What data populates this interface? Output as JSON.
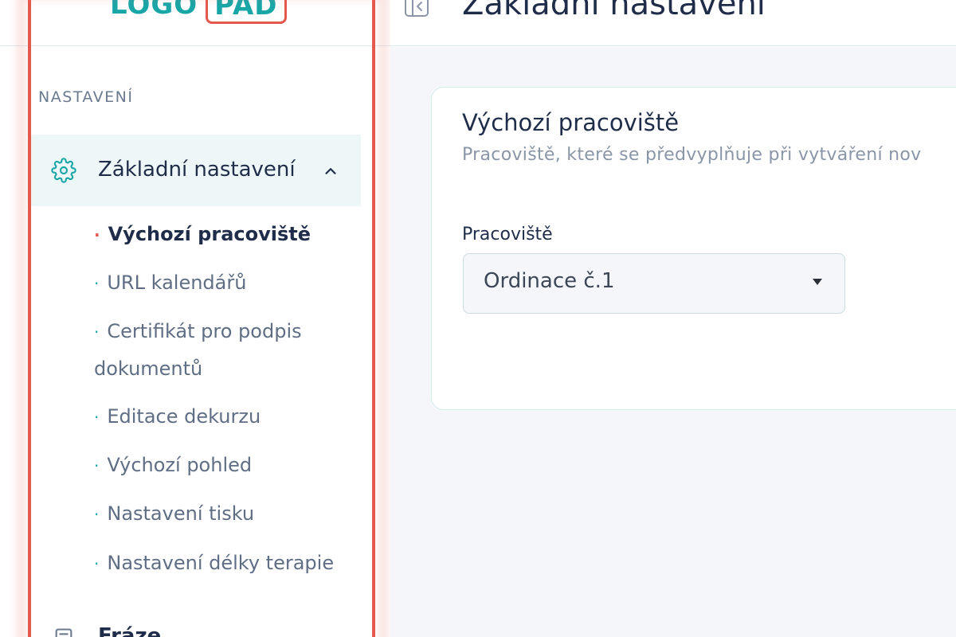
{
  "logo": {
    "left_text": "LOGO",
    "right_text": "PAD"
  },
  "sidebar": {
    "section_label": "NASTAVENÍ",
    "active_group": {
      "label": "Základní nastavení",
      "icon": "gear-icon"
    },
    "sub_items": [
      {
        "label": "Výchozí pracoviště",
        "active": true
      },
      {
        "label": "URL kalendářů",
        "active": false
      },
      {
        "label": "Certifikát pro podpis dokumentů",
        "active": false
      },
      {
        "label": "Editace dekurzu",
        "active": false
      },
      {
        "label": "Výchozí pohled",
        "active": false
      },
      {
        "label": "Nastavení tisku",
        "active": false
      },
      {
        "label": "Nastavení délky terapie",
        "active": false
      }
    ],
    "next_group": {
      "label": "Fráze",
      "icon": "document-icon"
    }
  },
  "header": {
    "title": "Základní nastavení"
  },
  "card": {
    "title": "Výchozí pracoviště",
    "description": "Pracoviště, které se předvyplňuje při vytváření nov",
    "field_label": "Pracoviště",
    "select_value": "Ordinace č.1"
  },
  "colors": {
    "accent": "#19a6a7",
    "highlight": "#e5584e",
    "text": "#1f2d4a"
  }
}
